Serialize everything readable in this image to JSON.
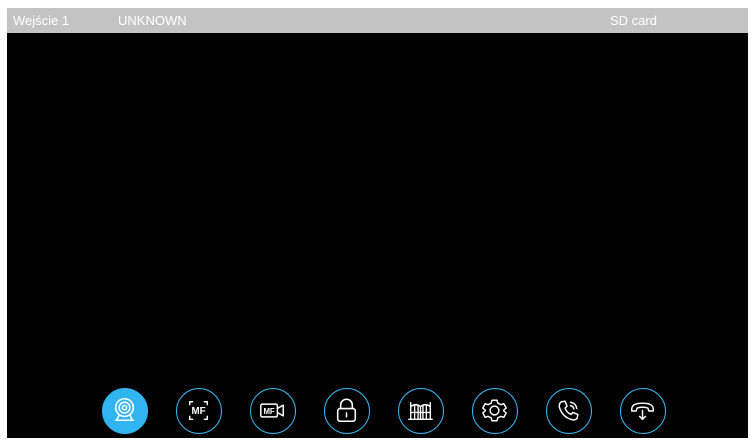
{
  "status_bar": {
    "input_label": "Wejście 1",
    "caller_label": "UNKNOWN",
    "storage_label": "SD card"
  },
  "toolbar": {
    "buttons": [
      {
        "name": "camera",
        "icon": "camera-icon",
        "active": true
      },
      {
        "name": "snapshot",
        "icon": "mf-snapshot-icon",
        "text": "MF",
        "active": false
      },
      {
        "name": "record",
        "icon": "mf-video-icon",
        "text": "MF",
        "active": false
      },
      {
        "name": "unlock",
        "icon": "lock-icon",
        "active": false
      },
      {
        "name": "gate",
        "icon": "gate-icon",
        "active": false
      },
      {
        "name": "settings",
        "icon": "gear-icon",
        "active": false
      },
      {
        "name": "answer",
        "icon": "phone-icon",
        "active": false
      },
      {
        "name": "hang-up",
        "icon": "hang-up-icon",
        "active": false
      }
    ]
  },
  "colors": {
    "accent": "#37b6ee",
    "active_fill": "#31b5f0",
    "status_bar": "#c3c3c3",
    "screen": "#000000"
  }
}
